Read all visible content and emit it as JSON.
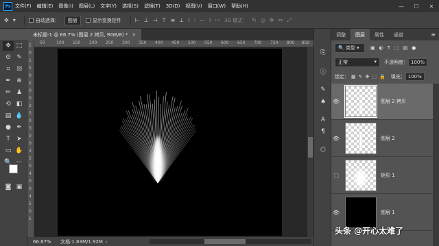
{
  "app": {
    "logo": "Ps"
  },
  "menu": [
    "文件(F)",
    "编辑(E)",
    "图像(I)",
    "图层(L)",
    "文字(Y)",
    "选择(S)",
    "滤镜(T)",
    "3D(D)",
    "视图(V)",
    "窗口(W)",
    "帮助(H)"
  ],
  "window_controls": {
    "minimize": "—",
    "maximize": "☐",
    "close": "✕"
  },
  "options": {
    "auto_select_label": "自动选择：",
    "auto_select_value": "图层",
    "show_transform_label": "显示变换控件",
    "mode_3d_label": "3D 模式："
  },
  "document": {
    "tab_title": "未标题-1 @ 66.7% (图层 2 拷贝, RGB/8) *"
  },
  "rulers": {
    "top": [
      "50",
      "100",
      "150",
      "200",
      "250",
      "300",
      "350",
      "400",
      "450",
      "500",
      "550",
      "600",
      "650",
      "700",
      "750",
      "800",
      "850"
    ],
    "left": [
      "5",
      "0",
      "1",
      "5",
      "0",
      "2",
      "0",
      "0",
      "2",
      "5",
      "0",
      "3",
      "0",
      "0",
      "3",
      "5",
      "0",
      "4",
      "0",
      "0",
      "4",
      "5",
      "0",
      "5"
    ]
  },
  "status": {
    "zoom": "66.67%",
    "doc_info": "文档:1.83M/1.92M"
  },
  "panel": {
    "tabs": [
      "调整",
      "图层",
      "属性",
      "通道"
    ],
    "active_tab": "图层",
    "filter_kind": "类型",
    "blend_mode": "正常",
    "opacity_label": "不透明度：",
    "opacity_value": "100%",
    "lock_label": "锁定：",
    "fill_label": "填充：",
    "fill_value": "100%",
    "layers": [
      {
        "name": "图层 2 拷贝",
        "visible": true,
        "selected": true,
        "thumb": "light-rays"
      },
      {
        "name": "图层 2",
        "visible": true,
        "selected": false,
        "thumb": "light-line"
      },
      {
        "name": "矩形 1",
        "visible": false,
        "selected": false,
        "thumb": "blur-shape"
      },
      {
        "name": "图层 1",
        "visible": true,
        "selected": false,
        "thumb": "black"
      }
    ]
  },
  "watermark": "头条 @开心太难了",
  "colors": {
    "canvas": "#000000",
    "accent": "#31a8ff",
    "panel_bg": "#535353",
    "menubar": "#323232"
  }
}
